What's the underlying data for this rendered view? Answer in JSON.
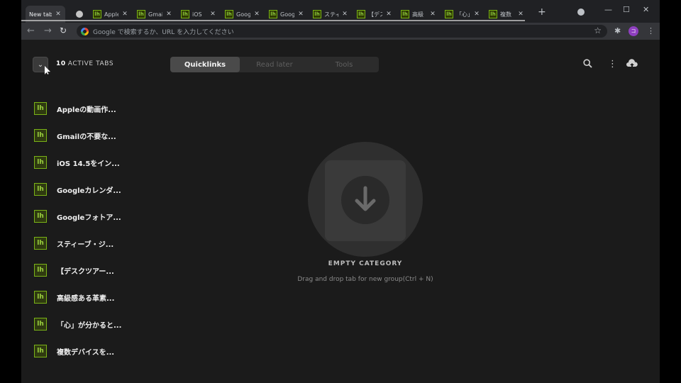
{
  "browser": {
    "tabs": [
      {
        "title": "New tab",
        "favicon": "none",
        "active": true
      },
      {
        "title": "",
        "favicon": "circle"
      },
      {
        "title": "Apple",
        "favicon": "lh"
      },
      {
        "title": "Gmail",
        "favicon": "lh"
      },
      {
        "title": "iOS",
        "favicon": "lh"
      },
      {
        "title": "Goog",
        "favicon": "lh"
      },
      {
        "title": "Goog",
        "favicon": "lh"
      },
      {
        "title": "スティ",
        "favicon": "lh"
      },
      {
        "title": "【デス",
        "favicon": "lh"
      },
      {
        "title": "高級",
        "favicon": "lh"
      },
      {
        "title": "「心」",
        "favicon": "lh"
      },
      {
        "title": "複数",
        "favicon": "lh"
      }
    ],
    "favicon_text": "lh",
    "close_glyph": "✕",
    "new_tab_glyph": "+",
    "minimize_glyph": "—",
    "maximize_glyph": "☐",
    "close_window_glyph": "✕",
    "omnibox_placeholder": "Google で検索するか、URL を入力してください",
    "avatar_text": "コ"
  },
  "header": {
    "collapse_glyph": "⌄",
    "active_count": "10",
    "active_label": "ACTIVE TABS"
  },
  "tabs_switch": [
    {
      "label": "Quicklinks",
      "active": true
    },
    {
      "label": "Read later",
      "active": false
    },
    {
      "label": "Tools",
      "active": false
    }
  ],
  "active_tabs": [
    "Appleの動画作...",
    "Gmailの不要な...",
    "iOS 14.5をイン...",
    "Googleカレンダ...",
    "Googleフォトア...",
    "スティーブ・ジ...",
    "【デスクツアー...",
    "高級感ある革素...",
    "「心」が分かると...",
    "複数デバイスを..."
  ],
  "empty_state": {
    "title": "EMPTY CATEGORY",
    "subtitle": "Drag and drop tab for new group(Ctrl + N)"
  },
  "colors": {
    "accent_green": "#7ab317",
    "background": "#1b1b1b"
  }
}
